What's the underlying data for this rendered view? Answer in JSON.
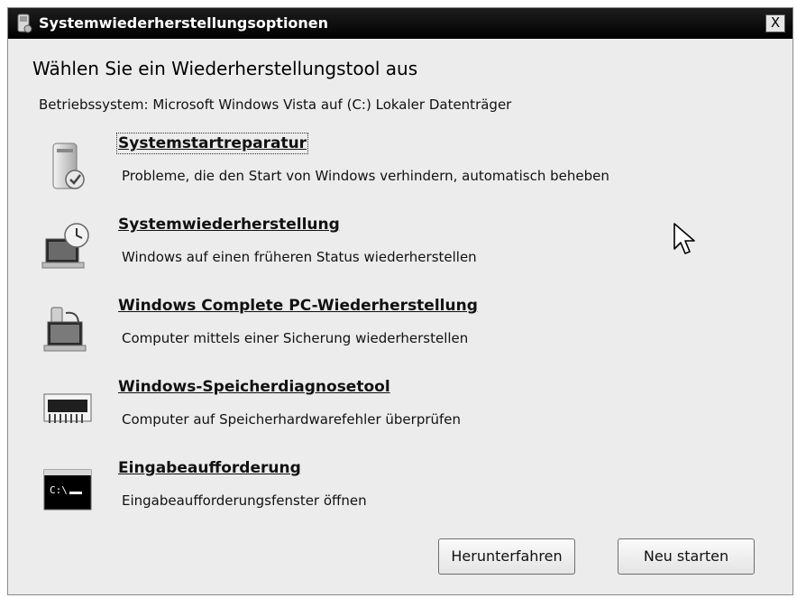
{
  "window": {
    "title": "Systemwiederherstellungsoptionen",
    "close_label": "X"
  },
  "heading": "Wählen Sie ein Wiederherstellungstool aus",
  "os_line": "Betriebssystem: Microsoft Windows Vista auf (C:) Lokaler Datenträger",
  "tools": [
    {
      "title": "Systemstartreparatur",
      "description": "Probleme, die den Start von Windows verhindern, automatisch beheben",
      "icon": "startup-repair-icon"
    },
    {
      "title": "Systemwiederherstellung",
      "description": "Windows auf einen früheren Status wiederherstellen",
      "icon": "system-restore-icon"
    },
    {
      "title": "Windows Complete PC-Wiederherstellung",
      "description": "Computer mittels einer Sicherung wiederherstellen",
      "icon": "complete-pc-restore-icon"
    },
    {
      "title": "Windows-Speicherdiagnosetool",
      "description": "Computer auf Speicherhardwarefehler überprüfen",
      "icon": "memory-chip-icon"
    },
    {
      "title": "Eingabeaufforderung",
      "description": "Eingabeaufforderungsfenster öffnen",
      "icon": "command-prompt-icon",
      "icon_text": "C:\\"
    }
  ],
  "buttons": {
    "shutdown": "Herunterfahren",
    "restart": "Neu starten"
  }
}
